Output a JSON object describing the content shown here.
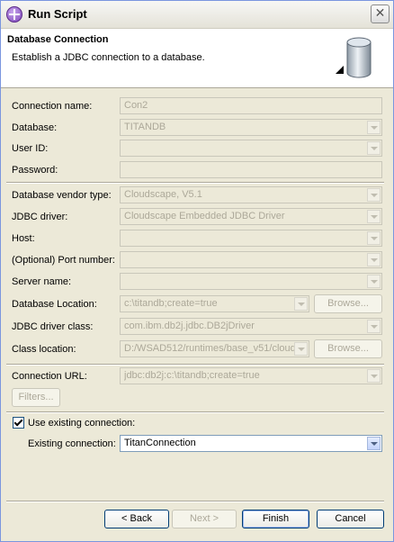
{
  "window": {
    "title": "Run Script"
  },
  "banner": {
    "title": "Database Connection",
    "description": "Establish a JDBC connection to a database."
  },
  "fields": {
    "connection_name": {
      "label": "Connection name:",
      "value": "Con2"
    },
    "database": {
      "label": "Database:",
      "value": "TITANDB"
    },
    "user_id": {
      "label": "User ID:",
      "value": ""
    },
    "password": {
      "label": "Password:",
      "value": ""
    },
    "vendor_type": {
      "label": "Database vendor type:",
      "value": "Cloudscape, V5.1"
    },
    "jdbc_driver": {
      "label": "JDBC driver:",
      "value": "Cloudscape Embedded JDBC Driver"
    },
    "host": {
      "label": "Host:",
      "value": ""
    },
    "port": {
      "label": "(Optional) Port number:",
      "value": ""
    },
    "server_name": {
      "label": "Server name:",
      "value": ""
    },
    "db_location": {
      "label": "Database Location:",
      "value": "c:\\titandb;create=true"
    },
    "driver_class": {
      "label": "JDBC driver class:",
      "value": "com.ibm.db2j.jdbc.DB2jDriver"
    },
    "class_location": {
      "label": "Class location:",
      "value": "D:/WSAD512/runtimes/base_v51/cloudscape/lib/db2j.jar"
    },
    "connection_url": {
      "label": "Connection URL:",
      "value": "jdbc:db2j:c:\\titandb;create=true"
    }
  },
  "buttons": {
    "browse": "Browse...",
    "filters": "Filters...",
    "back": "< Back",
    "next": "Next >",
    "finish": "Finish",
    "cancel": "Cancel"
  },
  "existing": {
    "checkbox_label": "Use existing connection:",
    "checked": true,
    "label": "Existing connection:",
    "value": "TitanConnection"
  },
  "colors": {
    "disabled_text": "#aca899",
    "dialog_bg": "#ece9d8",
    "banner_bg": "#ffffff"
  }
}
